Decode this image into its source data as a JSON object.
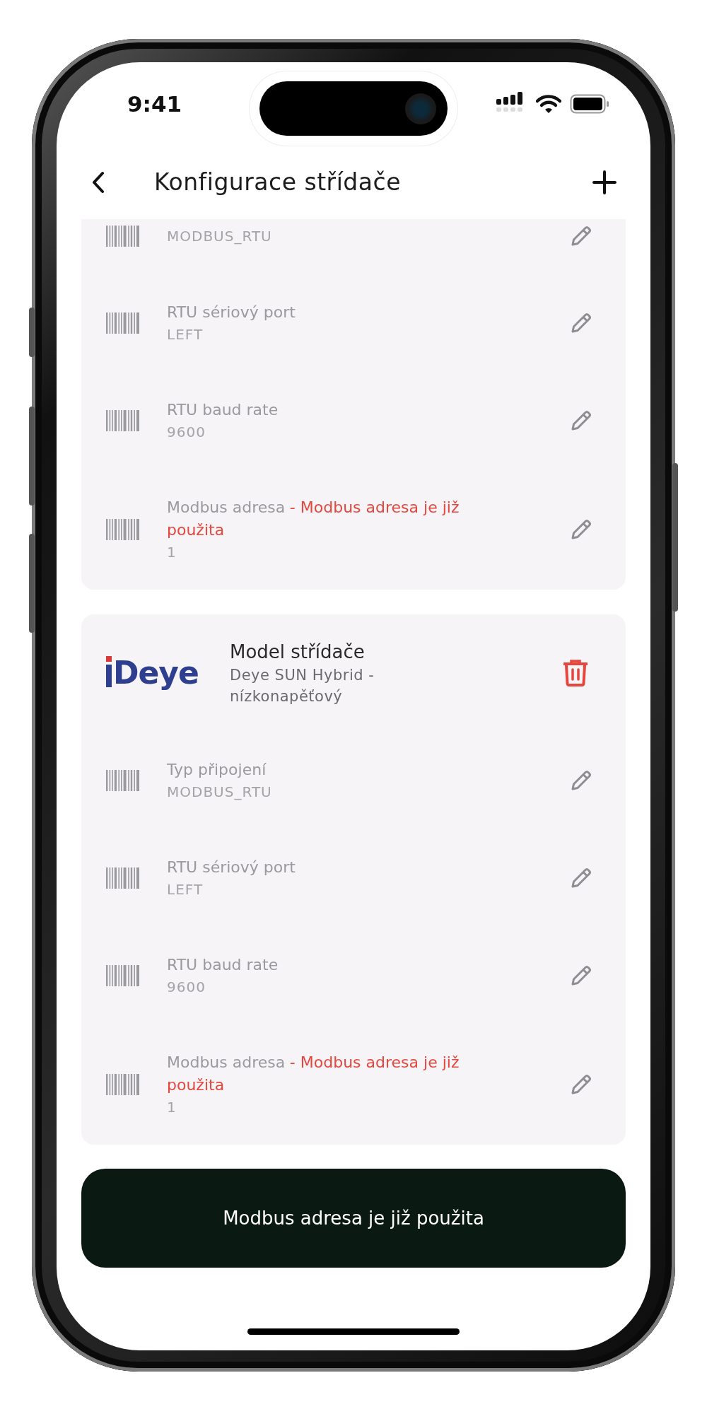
{
  "status_bar": {
    "time": "9:41"
  },
  "header": {
    "title": "Konfigurace střídače"
  },
  "inverters": [
    {
      "rows": [
        {
          "value": "MODBUS_RTU"
        },
        {
          "label": "RTU sériový port",
          "value": "LEFT"
        },
        {
          "label": "RTU baud rate",
          "value": "9600"
        },
        {
          "label": "Modbus adresa",
          "error": "- Modbus adresa je již použita",
          "value": "1"
        }
      ]
    },
    {
      "logo": "Deye",
      "model": {
        "title": "Model střídače",
        "name": "Deye SUN Hybrid - nízkonapěťový"
      },
      "rows": [
        {
          "label": "Typ připojení",
          "value": "MODBUS_RTU"
        },
        {
          "label": "RTU sériový port",
          "value": "LEFT"
        },
        {
          "label": "RTU baud rate",
          "value": "9600"
        },
        {
          "label": "Modbus adresa",
          "error": "- Modbus adresa je již použita",
          "value": "1"
        }
      ]
    }
  ],
  "action_button": {
    "label": "Modbus adresa je již použita"
  }
}
